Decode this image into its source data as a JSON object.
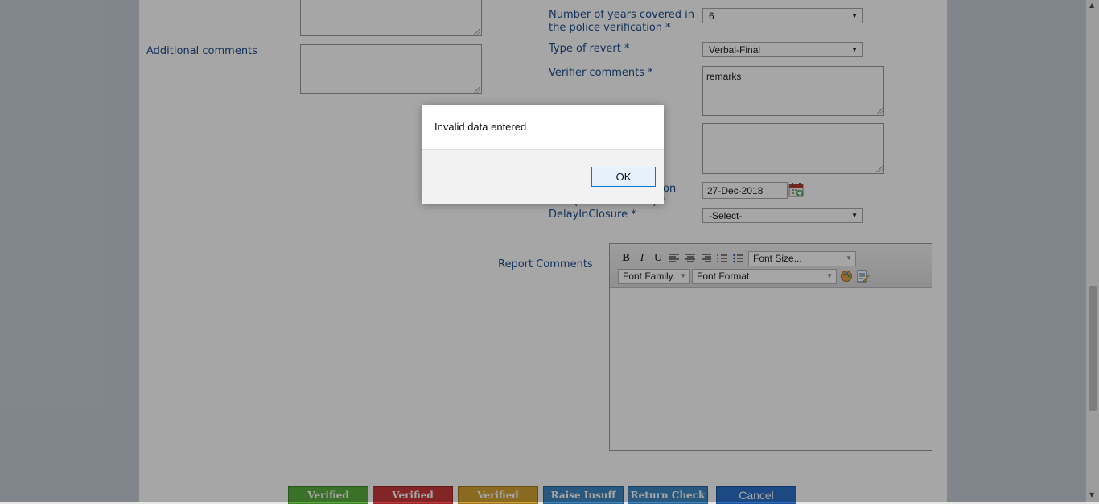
{
  "form": {
    "years_label_line1": "Number of years covered in",
    "years_label_line2": "the police verification *",
    "years_value": "6",
    "additional_comments_label": "Additional comments",
    "type_of_revert_label": "Type of revert *",
    "type_of_revert_value": "Verbal-Final",
    "verifier_comments_label": "Verifier comments *",
    "verifier_comments_value": "remarks",
    "closure_label_line1": "on",
    "closure_label_line2": "Date(DD-MMM-YYYY) *",
    "closure_date_value": "27-Dec-2018",
    "delay_label": "DelayInClosure *",
    "delay_value": "-Select-",
    "report_comments_label": "Report Comments"
  },
  "editor": {
    "bold": "B",
    "italic": "I",
    "underline": "U",
    "font_size": "Font Size...",
    "font_family": "Font Family.",
    "font_format": "Font Format"
  },
  "buttons": {
    "verified_green": "Verified",
    "verified_red": "Verified",
    "verified_amber": "Verified",
    "raise_insuff": "Raise Insuff",
    "return_check": "Return Check",
    "cancel": "Cancel"
  },
  "colors": {
    "label_blue": "#1f4e8c",
    "green": "#5aac3e",
    "red": "#c9393c",
    "amber": "#d4a133",
    "blue": "#3f87c4",
    "cancel_blue": "#2c6fc9"
  },
  "dialog": {
    "message": "Invalid data entered",
    "ok_label": "OK"
  }
}
